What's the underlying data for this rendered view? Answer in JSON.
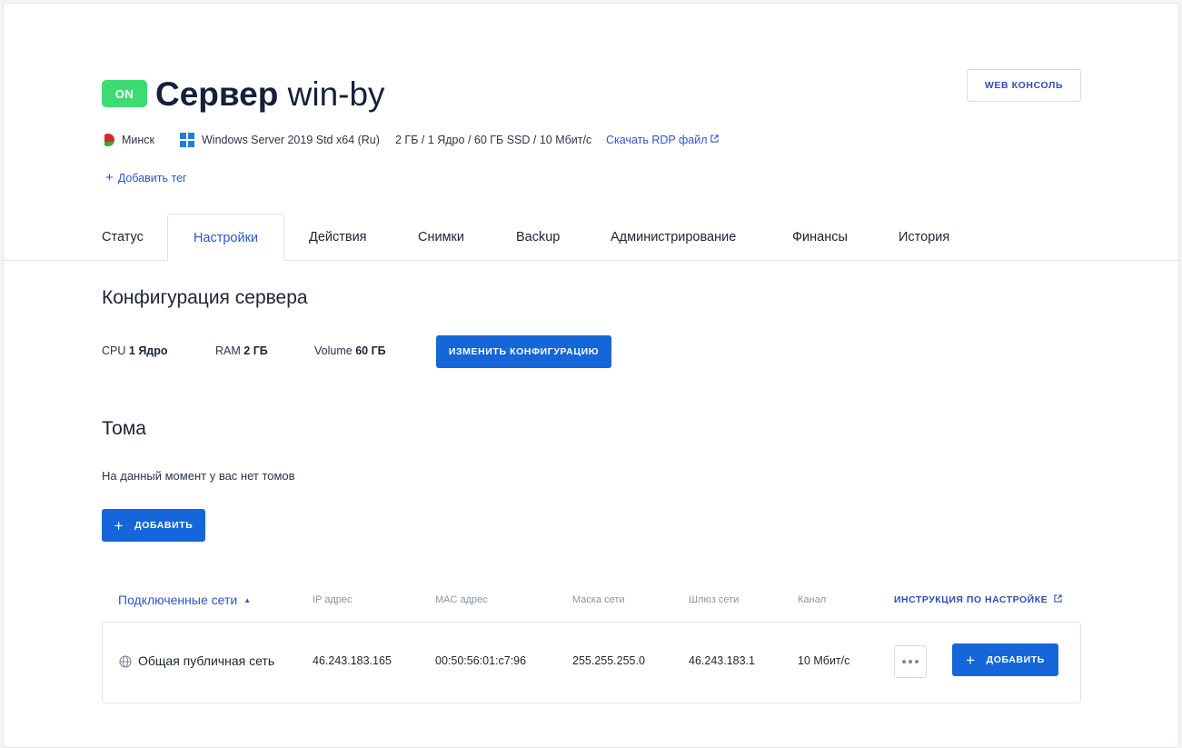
{
  "header": {
    "status_badge": "ON",
    "title_bold": "Сервер",
    "title_name": "win-by",
    "web_console_label": "WEB КОНСОЛЬ",
    "location": "Минск",
    "os": "Windows Server 2019 Std x64 (Ru)",
    "resources": "2 ГБ / 1 Ядро / 60 ГБ SSD / 10 Мбит/с",
    "rdp_link": "Скачать RDP файл",
    "add_tag": "Добавить тег"
  },
  "tabs": [
    {
      "label": "Статус"
    },
    {
      "label": "Настройки",
      "active": true
    },
    {
      "label": "Действия"
    },
    {
      "label": "Снимки"
    },
    {
      "label": "Backup"
    },
    {
      "label": "Администрирование"
    },
    {
      "label": "Финансы"
    },
    {
      "label": "История"
    }
  ],
  "config": {
    "title": "Конфигурация сервера",
    "cpu_label": "CPU",
    "cpu_value": "1 Ядро",
    "ram_label": "RAM",
    "ram_value": "2 ГБ",
    "volume_label": "Volume",
    "volume_value": "60 ГБ",
    "change_button": "ИЗМЕНИТЬ КОНФИГУРАЦИЮ"
  },
  "volumes": {
    "title": "Тома",
    "empty_text": "На данный момент у вас нет томов",
    "add_button": "ДОБАВИТЬ"
  },
  "networks": {
    "header_main": "Подключенные сети",
    "columns": {
      "ip": "IP адрес",
      "mac": "MAC адрес",
      "mask": "Маска сети",
      "gateway": "Шлюз сети",
      "channel": "Канал"
    },
    "instructions_link": "ИНСТРУКЦИЯ ПО НАСТРОЙКЕ",
    "rows": [
      {
        "name": "Общая публичная сеть",
        "ip": "46.243.183.165",
        "mac": "00:50:56:01:c7:96",
        "mask": "255.255.255.0",
        "gateway": "46.243.183.1",
        "channel": "10 Мбит/с"
      }
    ],
    "add_button": "ДОБАВИТЬ"
  },
  "colors": {
    "accent": "#1566d8",
    "link": "#2e55c6",
    "status_on": "#3ddc73"
  },
  "icons": {
    "location_flag": "belarus-flag-icon",
    "os": "windows-icon",
    "external": "external-link-icon",
    "network": "globe-icon",
    "more": "more-dots-icon"
  }
}
